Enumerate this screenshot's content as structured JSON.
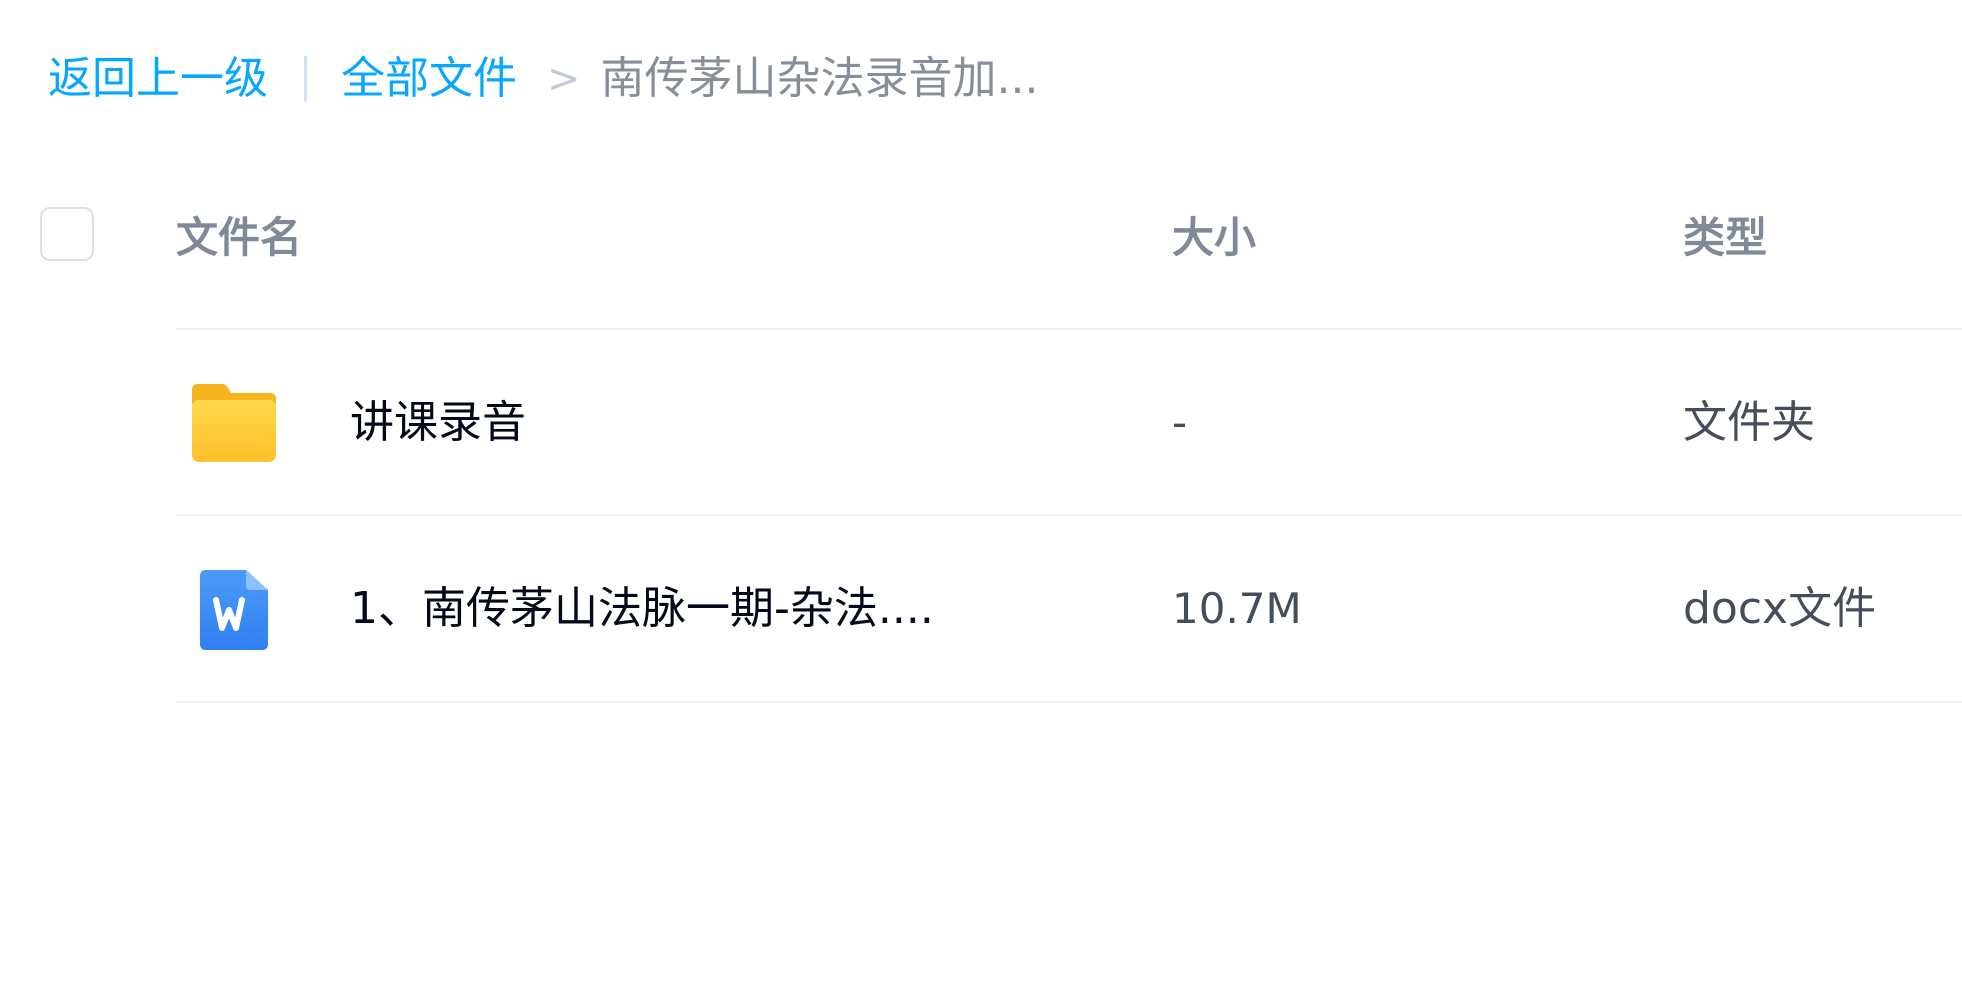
{
  "breadcrumb": {
    "back_label": "返回上一级",
    "root_label": "全部文件",
    "separator": ">",
    "current_label": "南传茅山杂法录音加..."
  },
  "table": {
    "columns": {
      "name": "文件名",
      "size": "大小",
      "type": "类型"
    },
    "rows": [
      {
        "icon": "folder-icon",
        "name": "讲课录音",
        "size": "-",
        "type": "文件夹"
      },
      {
        "icon": "docx-icon",
        "name": "1、南传茅山法脉一期-杂法....",
        "size": "10.7M",
        "type": "docx文件"
      }
    ]
  },
  "colors": {
    "link": "#06a7ff",
    "folder": "#ffc533",
    "docx": "#3b8cf5"
  }
}
